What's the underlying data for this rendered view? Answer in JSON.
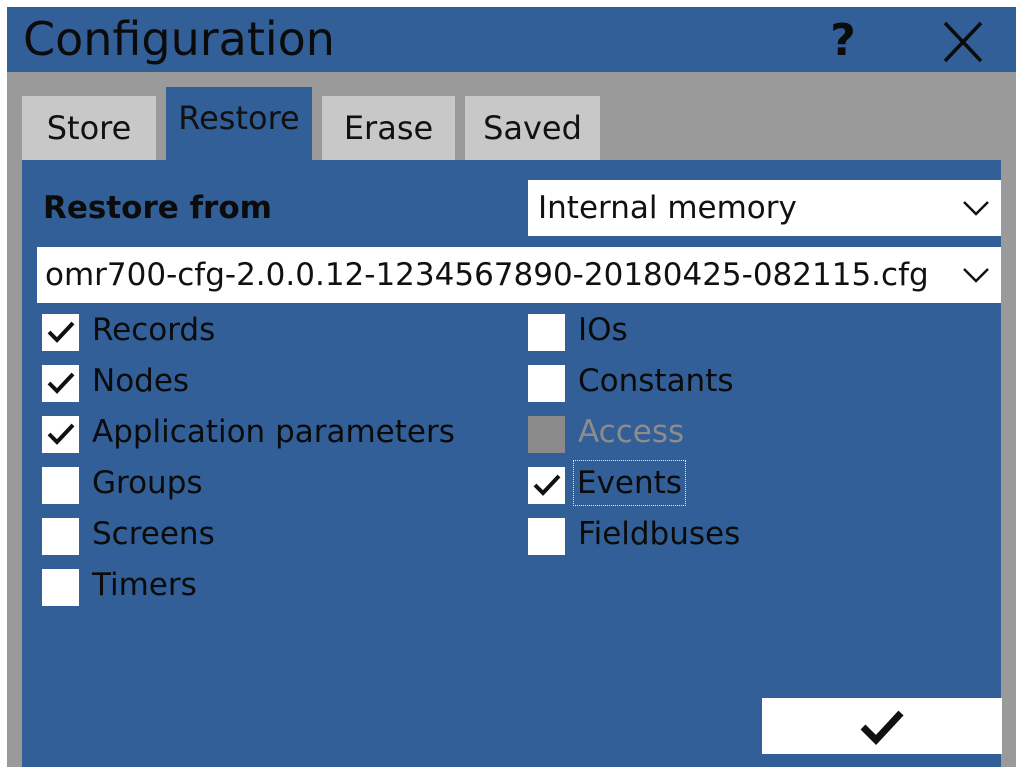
{
  "window": {
    "title": "Configuration"
  },
  "titlebar": {
    "help_label": "?",
    "close_icon": "close-icon"
  },
  "tabs": [
    {
      "label": "Store",
      "active": false
    },
    {
      "label": "Restore",
      "active": true
    },
    {
      "label": "Erase",
      "active": false
    },
    {
      "label": "Saved",
      "active": false
    }
  ],
  "restore": {
    "from_label": "Restore from",
    "source_value": "Internal memory",
    "file_value": "omr700-cfg-2.0.0.12-1234567890-20180425-082115.cfg"
  },
  "checkboxes": {
    "left": [
      {
        "label": "Records",
        "checked": true,
        "enabled": true
      },
      {
        "label": "Nodes",
        "checked": true,
        "enabled": true
      },
      {
        "label": "Application parameters",
        "checked": true,
        "enabled": true
      },
      {
        "label": "Groups",
        "checked": false,
        "enabled": true
      },
      {
        "label": "Screens",
        "checked": false,
        "enabled": true
      },
      {
        "label": "Timers",
        "checked": false,
        "enabled": true
      }
    ],
    "right": [
      {
        "label": "IOs",
        "checked": false,
        "enabled": true
      },
      {
        "label": "Constants",
        "checked": false,
        "enabled": true
      },
      {
        "label": "Access",
        "checked": false,
        "enabled": false
      },
      {
        "label": "Events",
        "checked": true,
        "enabled": true,
        "focused": true
      },
      {
        "label": "Fieldbuses",
        "checked": false,
        "enabled": true
      }
    ]
  },
  "confirm": {
    "icon": "checkmark-icon"
  },
  "colors": {
    "panel": "#325f98",
    "frame": "#9a9a9a",
    "tab_inactive": "#c8c8c8",
    "disabled": "#8a8a8a"
  }
}
